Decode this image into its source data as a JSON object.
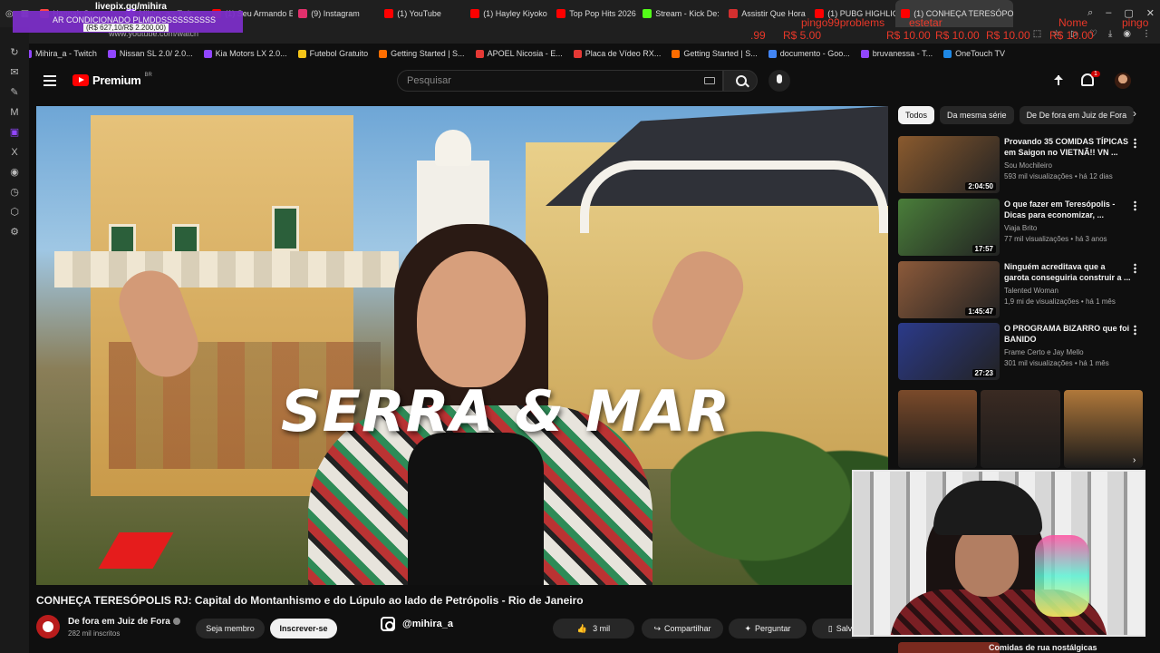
{
  "browser": {
    "tabs": [
      {
        "label": "Hannah Sn",
        "color": "#ff4444"
      },
      {
        "label": "Mihira_a - Twit",
        "color": "#9146ff"
      },
      {
        "label": "(1) Seu Armando E",
        "color": "#ff0000"
      },
      {
        "label": "(9) Instagram",
        "color": "#e1306c"
      },
      {
        "label": "(1) YouTube",
        "color": "#ff0000"
      },
      {
        "label": "(1) Hayley Kiyoko",
        "color": "#ff0000"
      },
      {
        "label": "Top Pop Hits 2026",
        "color": "#ff0000"
      },
      {
        "label": "Stream - Kick De:",
        "color": "#53fc18"
      },
      {
        "label": "Assistir Que Hora",
        "color": "#d32f2f"
      },
      {
        "label": "(1) PUBG HIGHLIG",
        "color": "#ff0000"
      },
      {
        "label": "(1) CONHEÇA TERESÓPO",
        "color": "#ff0000",
        "active": true
      }
    ],
    "url": "www.youtube.com/watch",
    "bookmarks": [
      {
        "label": "Mihira_a - Twitch",
        "color": "#9146ff"
      },
      {
        "label": "Nissan SL 2.0/ 2.0...",
        "color": "#9146ff"
      },
      {
        "label": "Kia Motors LX 2.0...",
        "color": "#9146ff"
      },
      {
        "label": "Futebol Gratuito",
        "color": "#f5c518"
      },
      {
        "label": "Getting Started | S...",
        "color": "#ff6d00"
      },
      {
        "label": "APOEL Nicosia - E...",
        "color": "#e53935"
      },
      {
        "label": "Placa de Vídeo RX...",
        "color": "#e53935"
      },
      {
        "label": "Getting Started | S...",
        "color": "#ff6d00"
      },
      {
        "label": "documento - Goo...",
        "color": "#4285f4"
      },
      {
        "label": "bruvanessa - T...",
        "color": "#9146ff"
      },
      {
        "label": "OneTouch TV",
        "color": "#1e88e5"
      }
    ]
  },
  "overlays": {
    "livepix": "livepix.gg/mihira",
    "donation_line1": "AR CONDICIONADO PLMDDSSSSSSSSSS",
    "donation_line2": "(R$ 627,10/R$ 2.200,00)",
    "red_texts": [
      ".99",
      "R$ 5.00",
      "pingo99problems",
      "estetar",
      "R$ 10.00",
      "R$ 10.00",
      "R$ 10.00",
      "R$ 10.00",
      "Nome",
      "pingo"
    ]
  },
  "youtube": {
    "brand": "Premium",
    "brand_region": "BR",
    "search_placeholder": "Pesquisar",
    "notification_count": "1",
    "video": {
      "overlay_text": "SERRA & MAR",
      "title": "CONHEÇA TERESÓPOLIS RJ: Capital do Montanhismo e do Lúpulo ao lado de Petrópolis - Rio de Janeiro",
      "channel": "De fora em Juiz de Fora",
      "subscribers": "282 mil inscritos",
      "member_label": "Seja membro",
      "subscribe_label": "Inscrever-se",
      "instagram_handle": "@mihira_a",
      "like_count": "3 mil",
      "share_label": "Compartilhar",
      "ask_label": "Perguntar",
      "save_label": "Salvar"
    },
    "chips": [
      "Todos",
      "Da mesma série",
      "De De fora em Juiz de Fora"
    ],
    "recommendations": [
      {
        "title": "Provando 35 COMIDAS TÍPICAS em Saigon no VIETNÃ!! VN ...",
        "channel": "Sou Mochileiro",
        "meta": "593 mil visualizações • há 12 dias",
        "duration": "2:04:50",
        "thumb": "#8a5a2e"
      },
      {
        "title": "O que fazer em Teresópolis - Dicas para economizar, ...",
        "channel": "Viaja Brito",
        "meta": "77 mil visualizações • há 3 anos",
        "duration": "17:57",
        "thumb": "#4a7e3a"
      },
      {
        "title": "Ninguém acreditava que a garota conseguiria construir a ...",
        "channel": "Talented Woman",
        "meta": "1,9 mi de visualizações • há 1 mês",
        "duration": "1:45:47",
        "thumb": "#8c5a3a"
      },
      {
        "title": "O PROGRAMA BIZARRO que foi BANIDO",
        "channel": "Frame Certo e Jay Mello",
        "meta": "301 mil visualizações • há 1 mês",
        "duration": "27:23",
        "thumb": "#2b3a8a"
      }
    ],
    "shorts_colors": [
      "#7a4a2a",
      "#3a2a22",
      "#b0783a"
    ],
    "last_recommendation": "Comidas de rua nostálgicas"
  }
}
